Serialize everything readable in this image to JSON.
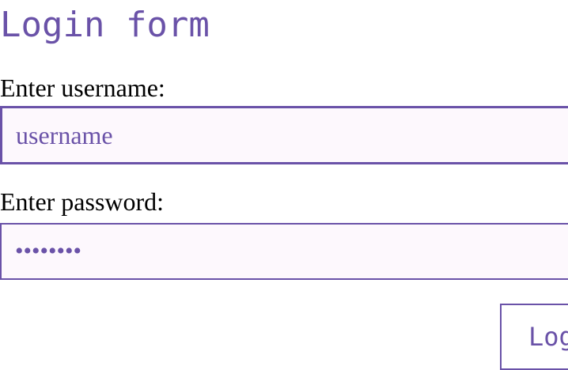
{
  "form": {
    "title": "Login form",
    "username_label": "Enter username:",
    "username_placeholder": "username",
    "username_value": "",
    "password_label": "Enter password:",
    "password_value": "password",
    "login_button_label": "Login"
  },
  "colors": {
    "accent": "#6a52a8",
    "field_background": "#fdf8fd",
    "label_text": "#000000"
  }
}
